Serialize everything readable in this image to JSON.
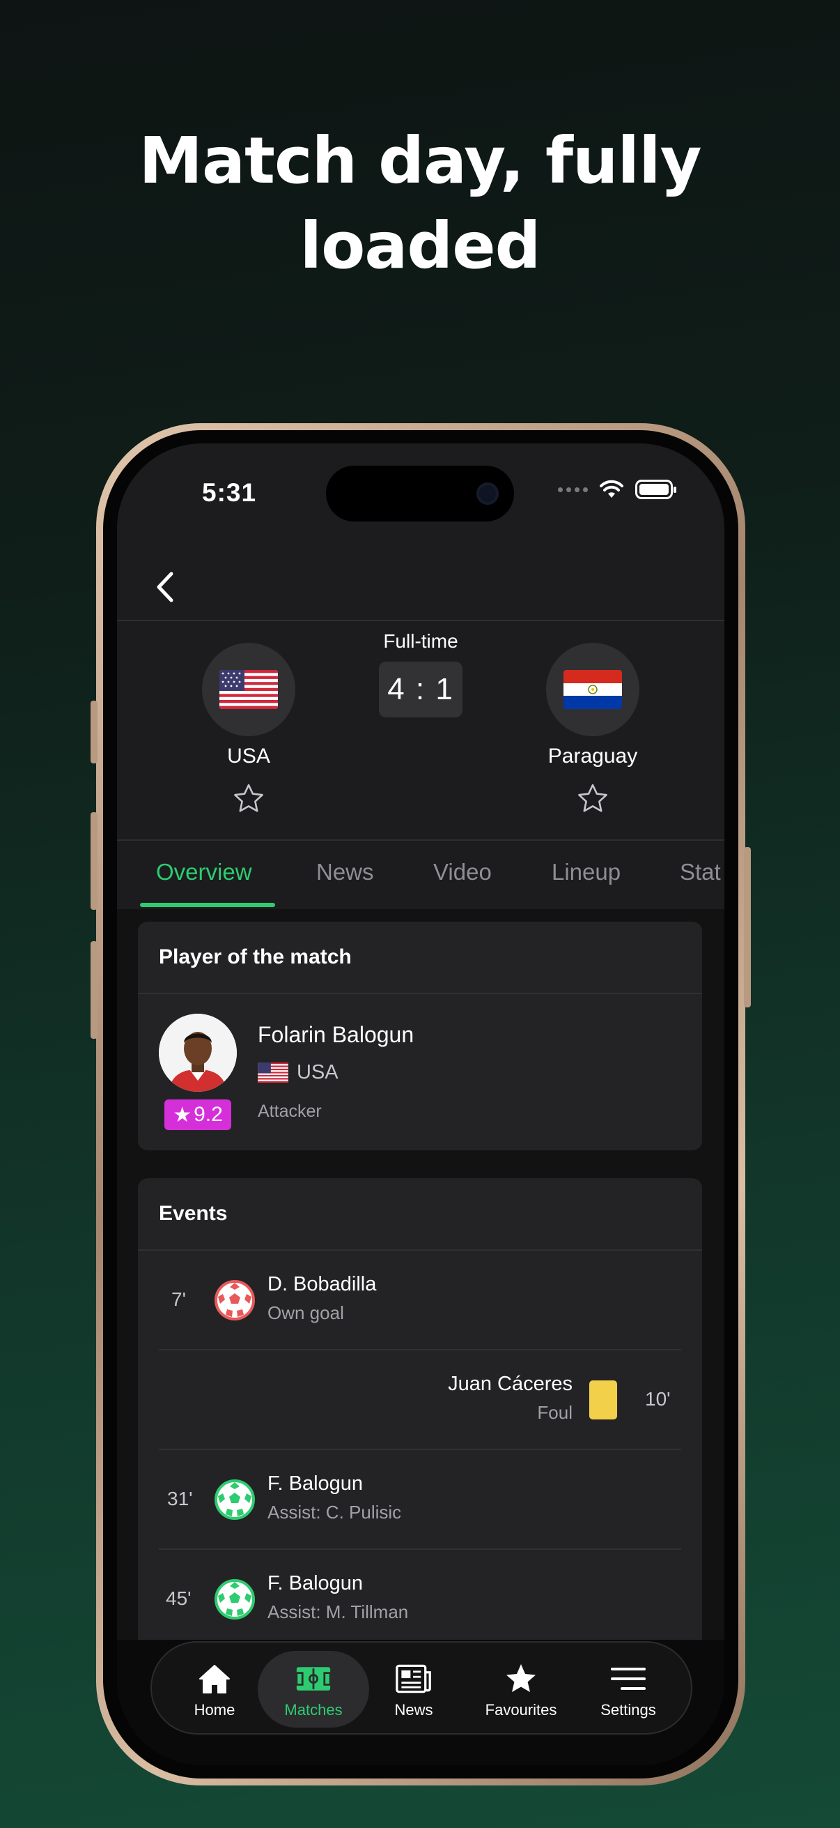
{
  "headline": {
    "line1": "Match day, fully",
    "line2": "loaded"
  },
  "status_bar": {
    "time": "5:31"
  },
  "match": {
    "status": "Full-time",
    "score": "4 : 1",
    "home": {
      "name": "USA",
      "flag": "us-flag-icon"
    },
    "away": {
      "name": "Paraguay",
      "flag": "paraguay-flag-icon"
    }
  },
  "tabs": [
    {
      "label": "Overview",
      "active": true
    },
    {
      "label": "News"
    },
    {
      "label": "Video"
    },
    {
      "label": "Lineup"
    },
    {
      "label": "Stat"
    }
  ],
  "player_of_match": {
    "title": "Player of the match",
    "rating": "9.2",
    "name": "Folarin Balogun",
    "country": "USA",
    "position": "Attacker"
  },
  "events": {
    "title": "Events",
    "items": [
      {
        "minute": "7'",
        "name": "D. Bobadilla",
        "detail": "Own goal",
        "side": "home",
        "type": "own-goal"
      },
      {
        "minute": "10'",
        "name": "Juan Cáceres",
        "detail": "Foul",
        "side": "away",
        "type": "yellow-card"
      },
      {
        "minute": "31'",
        "name": "F. Balogun",
        "detail": "Assist: C. Pulisic",
        "side": "home",
        "type": "goal"
      },
      {
        "minute": "45'",
        "name": "F. Balogun",
        "detail": "Assist: M. Tillman",
        "side": "home",
        "type": "goal"
      }
    ]
  },
  "nav": {
    "items": [
      {
        "label": "Home",
        "icon": "home-icon"
      },
      {
        "label": "Matches",
        "icon": "pitch-icon",
        "active": true
      },
      {
        "label": "News",
        "icon": "newspaper-icon"
      },
      {
        "label": "Favourites",
        "icon": "star-icon"
      },
      {
        "label": "Settings",
        "icon": "menu-icon"
      }
    ]
  },
  "colors": {
    "accent": "#2dcc70",
    "rating": "#d42fd8",
    "yellow_card": "#f2d04a",
    "own_goal": "#e85a5a"
  }
}
